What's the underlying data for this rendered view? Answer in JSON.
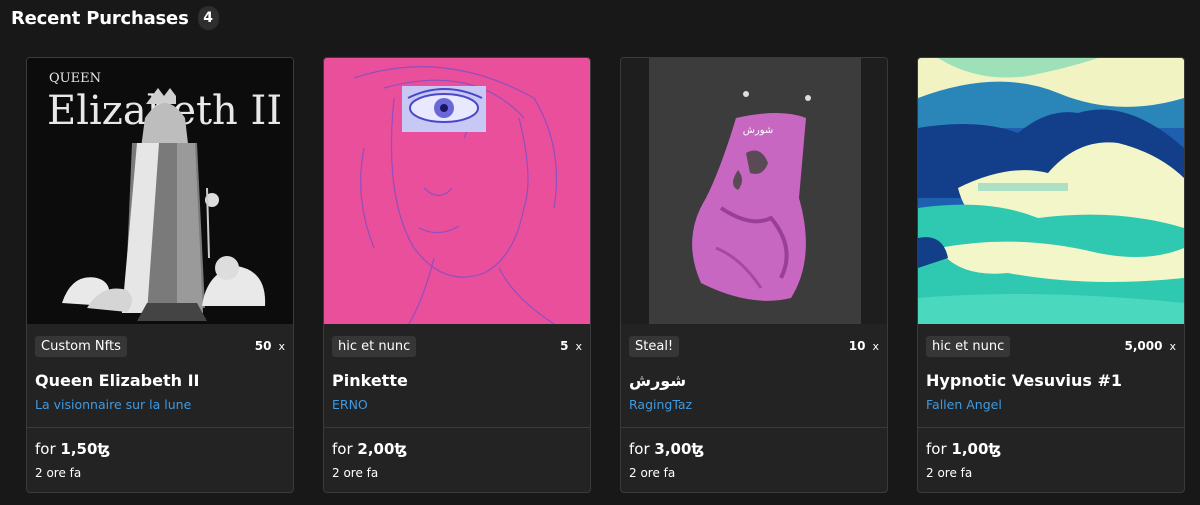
{
  "section": {
    "title": "Recent Purchases",
    "count": "4"
  },
  "cards": [
    {
      "tag": "Custom Nfts",
      "edition": "50",
      "edition_x": "x",
      "name": "Queen Elizabeth II",
      "creator": "La visionnaire sur la lune",
      "price_prefix": "for",
      "price": "1,50ꜩ",
      "time": "2 ore fa",
      "art": {
        "text_top": "QUEEN",
        "text_main": "Elizabeth II"
      }
    },
    {
      "tag": "hic et nunc",
      "edition": "5",
      "edition_x": "x",
      "name": "Pinkette",
      "creator": "ERNO",
      "price_prefix": "for",
      "price": "2,00ꜩ",
      "time": "2 ore fa"
    },
    {
      "tag": "Steal!",
      "edition": "10",
      "edition_x": "x",
      "name": "شورش",
      "creator": "RagingTaz",
      "price_prefix": "for",
      "price": "3,00ꜩ",
      "time": "2 ore fa",
      "art": {
        "text": "شورش"
      }
    },
    {
      "tag": "hic et nunc",
      "edition": "5,000",
      "edition_x": "x",
      "name": "Hypnotic Vesuvius #1",
      "creator": "Fallen Angel",
      "price_prefix": "for",
      "price": "1,00ꜩ",
      "time": "2 ore fa"
    }
  ],
  "colors": {
    "background": "#181818",
    "card": "#232323",
    "link": "#3f9ae0",
    "tag_bg": "#363636"
  }
}
